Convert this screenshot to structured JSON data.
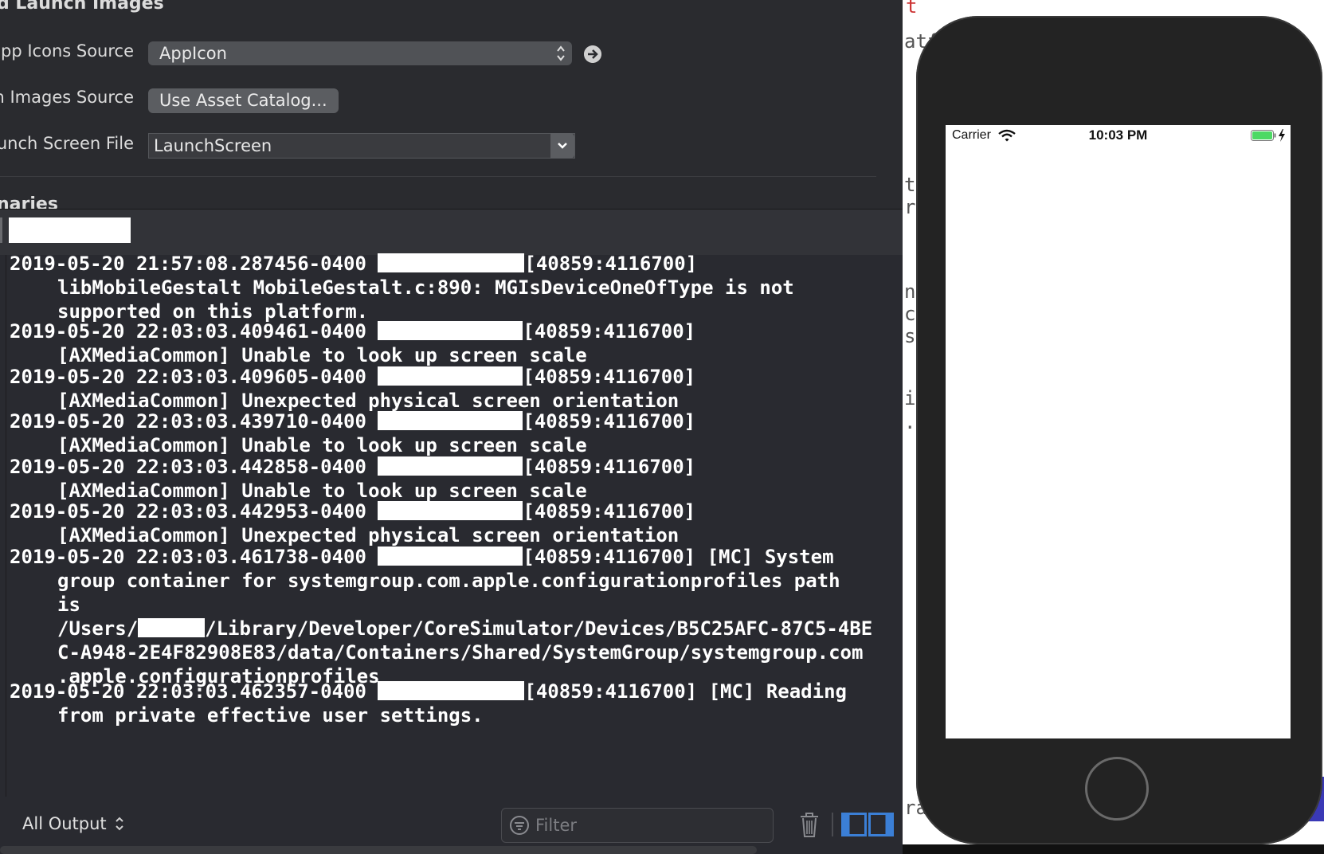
{
  "settings": {
    "section_title": "d Launch Images",
    "app_icons_label": "pp Icons Source",
    "app_icons_value": "AppIcon",
    "launch_images_label": "n Images Source",
    "use_asset_catalog_button": "Use Asset Catalog...",
    "launch_screen_label": "unch Screen File",
    "launch_screen_value": "LaunchScreen",
    "next_section_title": "naries"
  },
  "console": {
    "entries": [
      {
        "head": "2019-05-20 21:57:08.287456-0400 ",
        "pid": "[40859:4116700]",
        "tail": "",
        "lines": [
          "libMobileGestalt MobileGestalt.c:890: MGIsDeviceOneOfType is not",
          "supported on this platform."
        ]
      },
      {
        "head": "2019-05-20 22:03:03.409461-0400 ",
        "pid": "[40859:4116700]",
        "tail": "",
        "lines": [
          "[AXMediaCommon] Unable to look up screen scale"
        ]
      },
      {
        "head": "2019-05-20 22:03:03.409605-0400 ",
        "pid": "[40859:4116700]",
        "tail": "",
        "lines": [
          "[AXMediaCommon] Unexpected physical screen orientation"
        ]
      },
      {
        "head": "2019-05-20 22:03:03.439710-0400 ",
        "pid": "[40859:4116700]",
        "tail": "",
        "lines": [
          "[AXMediaCommon] Unable to look up screen scale"
        ]
      },
      {
        "head": "2019-05-20 22:03:03.442858-0400 ",
        "pid": "[40859:4116700]",
        "tail": "",
        "lines": [
          "[AXMediaCommon] Unable to look up screen scale"
        ]
      },
      {
        "head": "2019-05-20 22:03:03.442953-0400 ",
        "pid": "[40859:4116700]",
        "tail": "",
        "lines": [
          "[AXMediaCommon] Unexpected physical screen orientation"
        ]
      },
      {
        "head": "2019-05-20 22:03:03.461738-0400 ",
        "pid": "[40859:4116700]",
        "tail": " [MC] System",
        "lines": [
          "group container for systemgroup.com.apple.configurationprofiles path",
          "is",
          "/Users/#REDACT#/Library/Developer/CoreSimulator/Devices/B5C25AFC-87C5-4BE",
          "C-A948-2E4F82908E83/data/Containers/Shared/SystemGroup/systemgroup.com",
          ".apple.configurationprofiles"
        ]
      },
      {
        "head": "2019-05-20 22:03:03.462357-0400 ",
        "pid": "[40859:4116700]",
        "tail": " [MC] Reading",
        "lines": [
          "from private effective user settings."
        ]
      }
    ],
    "output_selector": "All Output",
    "filter_placeholder": "Filter"
  },
  "editor_fragments": [
    "t",
    "atfo",
    "tc",
    "r",
    "n",
    "c",
    "sc",
    "if",
    ".",
    "ra"
  ],
  "simulator": {
    "carrier": "Carrier",
    "time": "10:03 PM",
    "battery_color": "#4cd964"
  },
  "colors": {
    "xcode_bg": "#292a30",
    "console_text": "#ffffff",
    "accent_blue": "#3b7fd6"
  }
}
